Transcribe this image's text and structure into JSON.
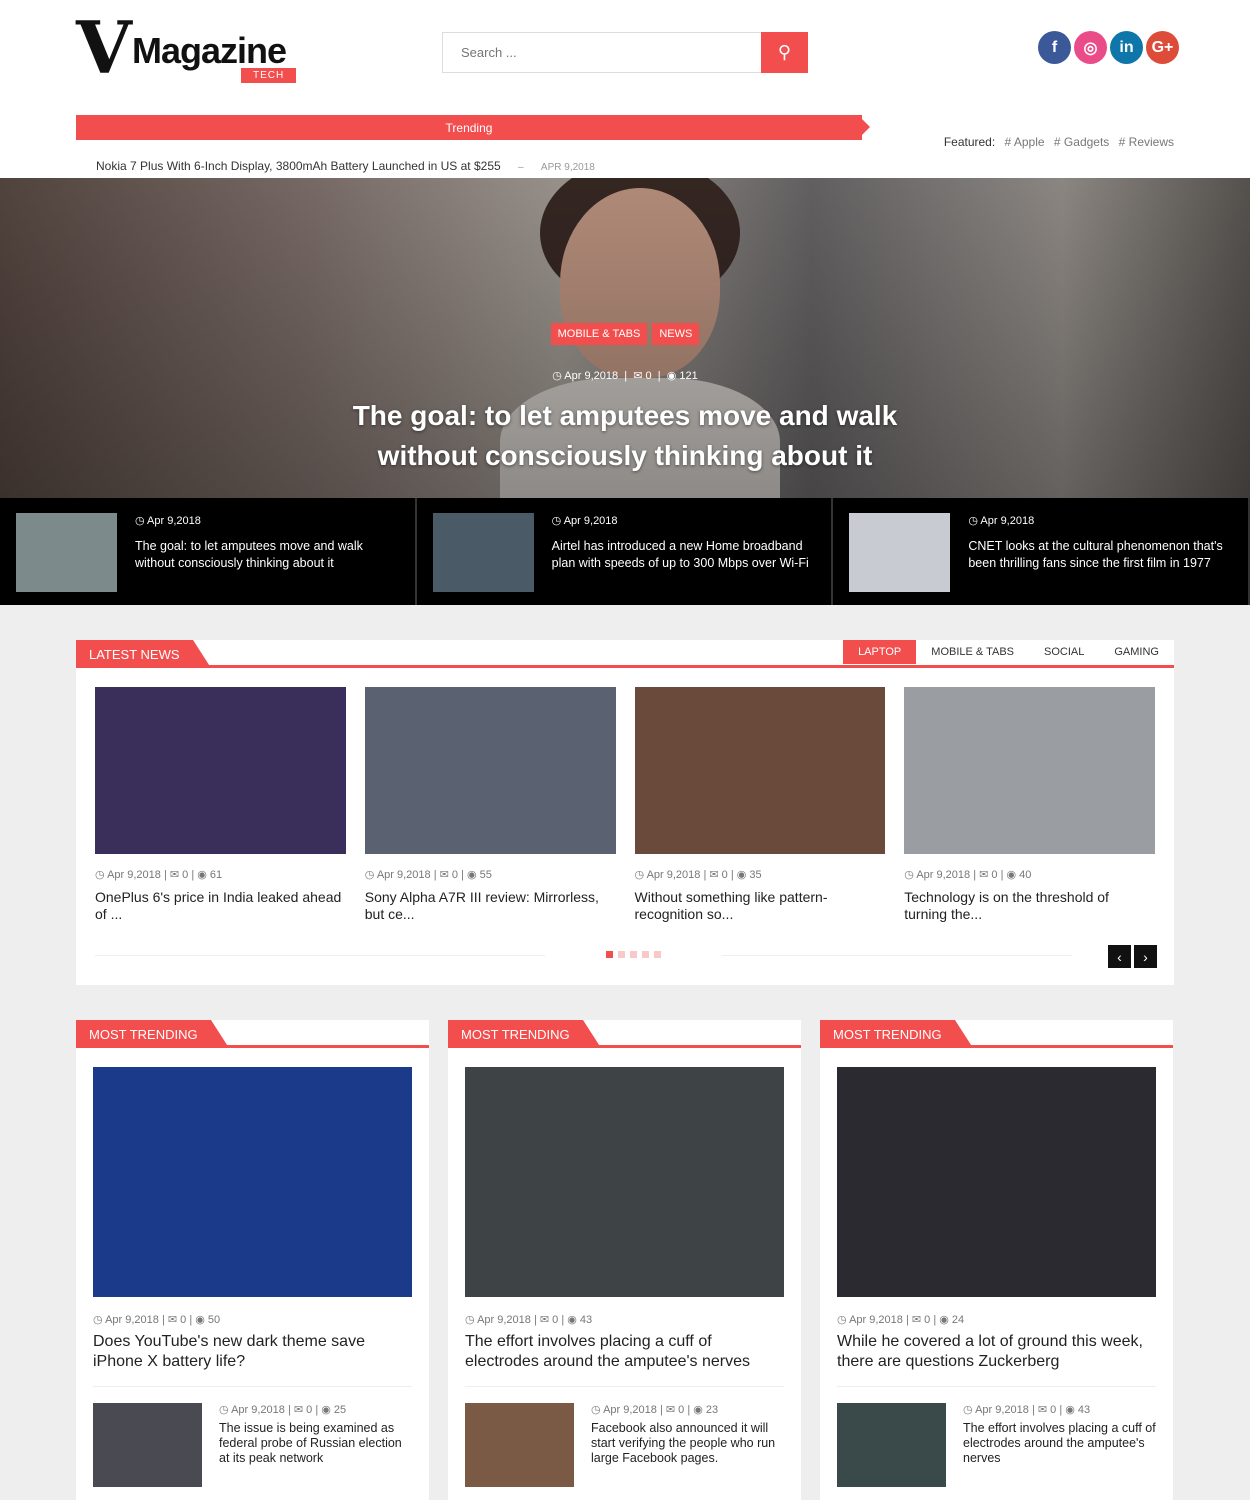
{
  "header": {
    "logo_mark": "V",
    "logo_text": "Magazine",
    "logo_sub": "TECH",
    "search_placeholder": "Search ...",
    "search_icon": "search-icon",
    "social": [
      {
        "name": "facebook",
        "glyph": "f",
        "color": "#3b5998"
      },
      {
        "name": "dribbble",
        "glyph": "◎",
        "color": "#ea4c89"
      },
      {
        "name": "linkedin",
        "glyph": "in",
        "color": "#0e76a8"
      },
      {
        "name": "google-plus",
        "glyph": "G+",
        "color": "#dd4b39"
      }
    ],
    "trending_label": "Trending",
    "featured_label": "Featured:",
    "featured_tags": [
      "# Apple",
      "# Gadgets",
      "# Reviews"
    ],
    "ticker_title": "Nokia 7 Plus With 6-Inch Display, 3800mAh Battery Launched in US at $255",
    "ticker_sep": "–",
    "ticker_date": "APR 9,2018"
  },
  "hero": {
    "tags": [
      "MOBILE & TABS",
      "NEWS"
    ],
    "date": "Apr 9,2018",
    "comments": "0",
    "views": "121",
    "title": "The goal: to let amputees move and walk without consciously thinking about it"
  },
  "strip": [
    {
      "date": "Apr 9,2018",
      "title": "The goal: to let amputees move and walk without consciously thinking about it",
      "color": "#7d8a8c"
    },
    {
      "date": "Apr 9,2018",
      "title": "Airtel has introduced a new Home broadband plan with speeds of up to 300 Mbps over Wi-Fi",
      "color": "#4a5a66"
    },
    {
      "date": "Apr 9,2018",
      "title": "CNET looks at the cultural phenomenon that's been thrilling fans since the first film in 1977",
      "color": "#c8ccd2"
    }
  ],
  "latest": {
    "label": "LATEST NEWS",
    "tabs": [
      "LAPTOP",
      "MOBILE & TABS",
      "SOCIAL",
      "GAMING"
    ],
    "active_tab": "LAPTOP",
    "cards": [
      {
        "date": "Apr 9,2018",
        "comments": "0",
        "views": "61",
        "title": "OnePlus 6's price in India leaked ahead of ...",
        "color": "#3a2f5a"
      },
      {
        "date": "Apr 9,2018",
        "comments": "0",
        "views": "55",
        "title": "Sony Alpha A7R III review: Mirrorless, but ce...",
        "color": "#5a6272"
      },
      {
        "date": "Apr 9,2018",
        "comments": "0",
        "views": "35",
        "title": "Without something like pattern-recognition so...",
        "color": "#6a4a3a"
      },
      {
        "date": "Apr 9,2018",
        "comments": "0",
        "views": "40",
        "title": "Technology is on the threshold of turning the...",
        "color": "#9a9ea2"
      }
    ],
    "pager_dots": 5,
    "active_dot": 0,
    "prev_glyph": "‹",
    "next_glyph": "›"
  },
  "trending": [
    {
      "label": "MOST TRENDING",
      "color": "#1b3a8a",
      "big": {
        "date": "Apr 9,2018",
        "comments": "0",
        "views": "50",
        "title": "Does YouTube's new dark theme save iPhone X battery life?"
      },
      "small": {
        "date": "Apr 9,2018",
        "comments": "0",
        "views": "25",
        "title": "The issue is being examined as federal probe of Russian election at its peak network",
        "color": "#4a4a52"
      }
    },
    {
      "label": "MOST TRENDING",
      "color": "#3e4446",
      "big": {
        "date": "Apr 9,2018",
        "comments": "0",
        "views": "43",
        "title": "The effort involves placing a cuff of electrodes around the amputee's nerves"
      },
      "small": {
        "date": "Apr 9,2018",
        "comments": "0",
        "views": "23",
        "title": "Facebook also announced it will start verifying the people who run large Facebook pages.",
        "color": "#7a5a44"
      }
    },
    {
      "label": "MOST TRENDING",
      "color": "#2a2a30",
      "big": {
        "date": "Apr 9,2018",
        "comments": "0",
        "views": "24",
        "title": "While he covered a lot of ground this week, there are questions Zuckerberg"
      },
      "small": {
        "date": "Apr 9,2018",
        "comments": "0",
        "views": "43",
        "title": "The effort involves placing a cuff of electrodes around the amputee's nerves",
        "color": "#3a4a4a"
      }
    }
  ],
  "icons": {
    "clock": "◷",
    "comment": "✉",
    "eye": "◉"
  }
}
